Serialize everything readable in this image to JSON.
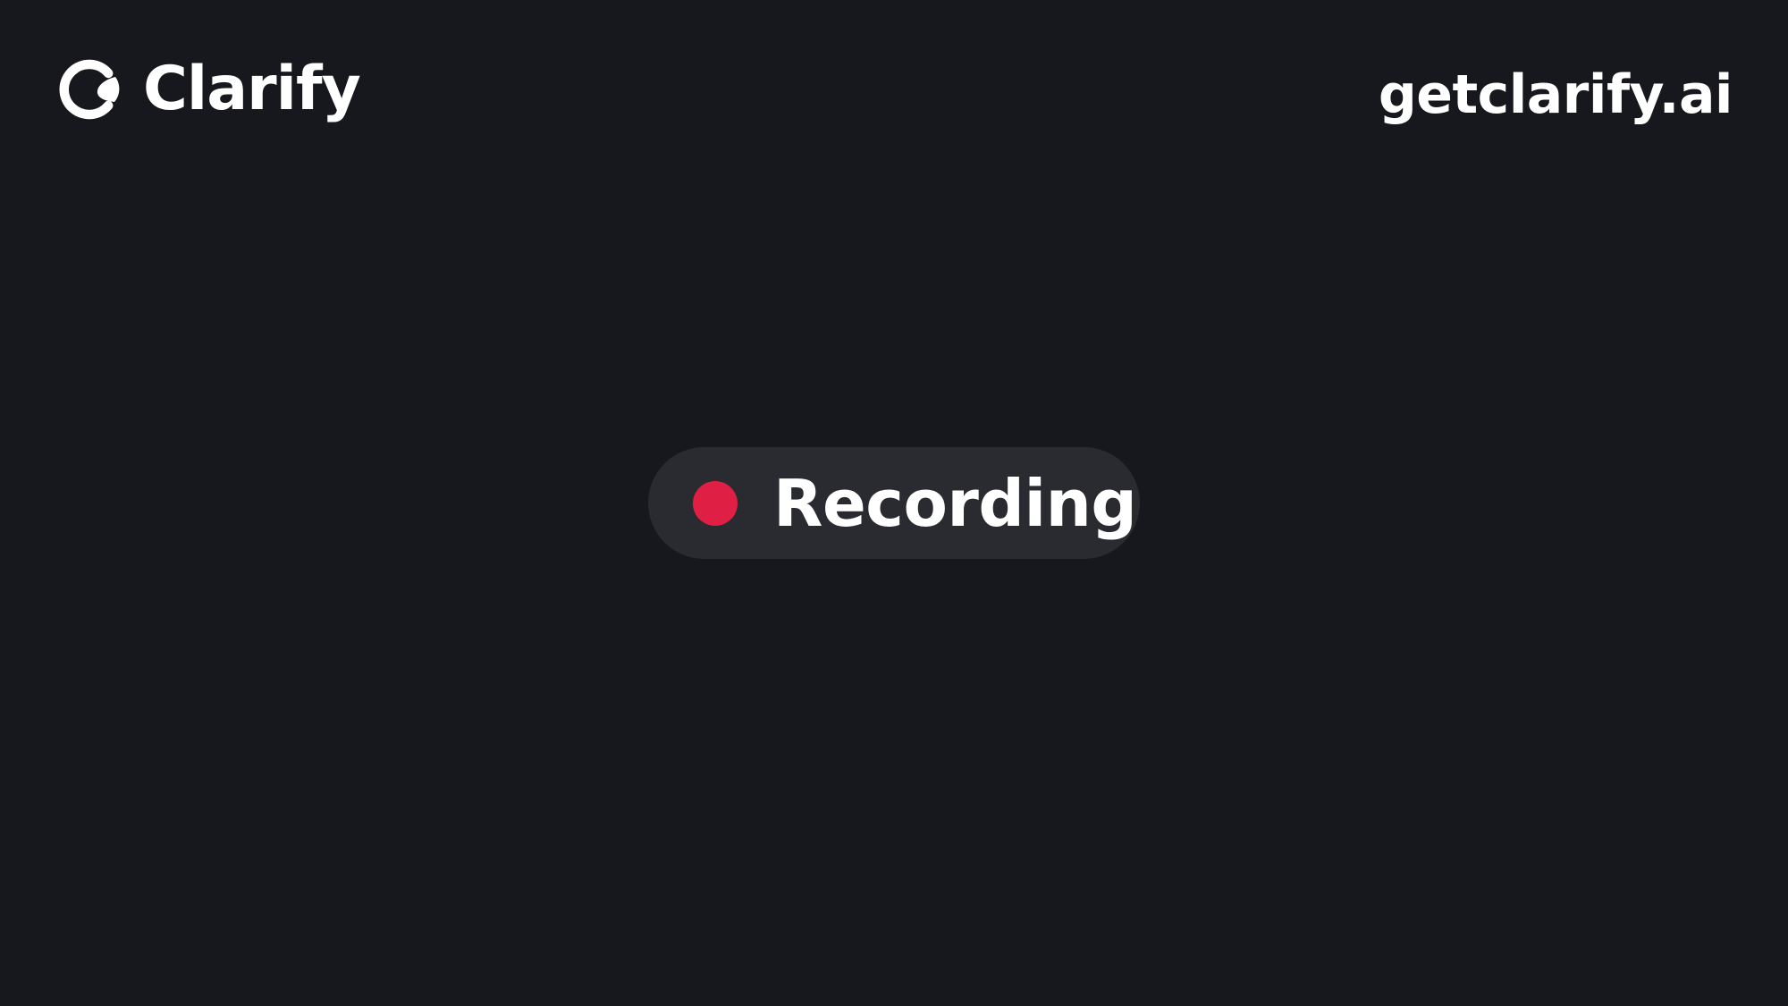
{
  "brand": {
    "name": "Clarify",
    "icon": "clarify-logo-icon"
  },
  "header": {
    "website": "getclarify.ai"
  },
  "status": {
    "label": "Recording",
    "icon": "recording-dot-icon",
    "dot_color": "#e01f44"
  },
  "colors": {
    "background": "#17181d",
    "pill": "#2a2b31",
    "text": "#ffffff"
  }
}
